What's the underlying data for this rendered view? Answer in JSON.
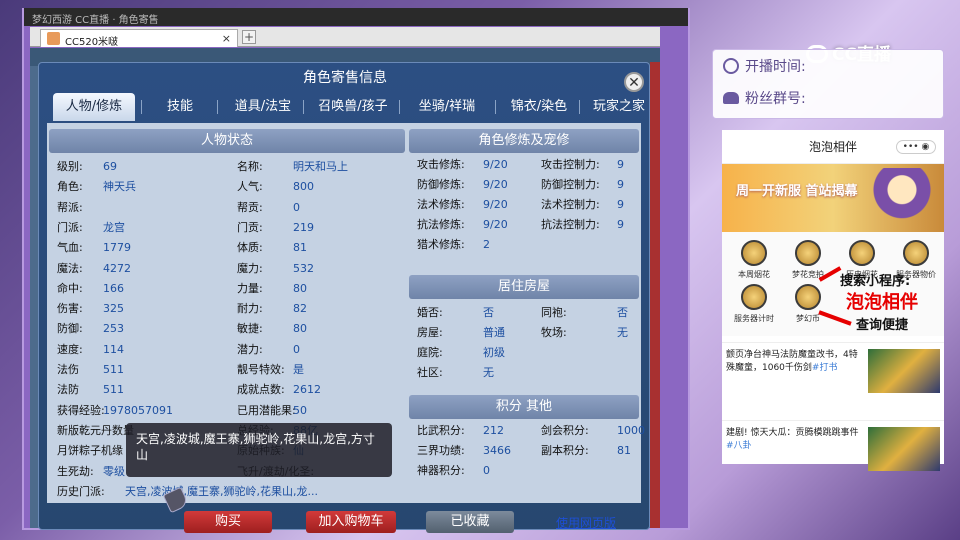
{
  "browser": {
    "tab_title": "CC520米啵",
    "close_glyph": "×",
    "newtab_glyph": "+"
  },
  "panel": {
    "title": "角色寄售信息",
    "close_glyph": "✕",
    "tabs": [
      "人物/修炼",
      "技能",
      "道具/法宝",
      "召唤兽/孩子",
      "坐骑/祥瑞",
      "锦衣/染色",
      "玩家之家"
    ],
    "active_tab": 0
  },
  "status": {
    "header": "人物状态",
    "left": [
      {
        "label": "级别:",
        "value": "69"
      },
      {
        "label": "角色:",
        "value": "神天兵"
      },
      {
        "label": "帮派:",
        "value": ""
      },
      {
        "label": "门派:",
        "value": "龙宫"
      },
      {
        "label": "气血:",
        "value": "1779"
      },
      {
        "label": "魔法:",
        "value": "4272"
      },
      {
        "label": "命中:",
        "value": "166"
      },
      {
        "label": "伤害:",
        "value": "325"
      },
      {
        "label": "防御:",
        "value": "253"
      },
      {
        "label": "速度:",
        "value": "114"
      },
      {
        "label": "法伤",
        "value": "511"
      },
      {
        "label": "法防",
        "value": "511"
      },
      {
        "label": "获得经验:",
        "value": "1978057091"
      },
      {
        "label": "新版乾元丹数量",
        "value": ""
      },
      {
        "label": "月饼粽子机缘",
        "value": ""
      },
      {
        "label": "生死劫:",
        "value": "零级"
      }
    ],
    "right": [
      {
        "label": "名称:",
        "value": "明天和马上"
      },
      {
        "label": "人气:",
        "value": "800"
      },
      {
        "label": "帮贡:",
        "value": "0"
      },
      {
        "label": "门贡:",
        "value": "219"
      },
      {
        "label": "体质:",
        "value": "81"
      },
      {
        "label": "魔力:",
        "value": "532"
      },
      {
        "label": "力量:",
        "value": "80"
      },
      {
        "label": "耐力:",
        "value": "82"
      },
      {
        "label": "敏捷:",
        "value": "80"
      },
      {
        "label": "潜力:",
        "value": "0"
      },
      {
        "label": "靓号特效:",
        "value": "是"
      },
      {
        "label": "成就点数:",
        "value": "2612"
      },
      {
        "label": "已用潜能果:",
        "value": "50"
      },
      {
        "label": "总经验:",
        "value": "88亿"
      },
      {
        "label": "原始种族:",
        "value": "仙"
      },
      {
        "label": "飞升/渡劫/化圣:",
        "value": ""
      }
    ],
    "history_label": "历史门派:",
    "history_value": "天宫,凌波城,魔王寨,狮驼岭,花果山,龙..."
  },
  "cultivation": {
    "header": "角色修炼及宠修",
    "rows": [
      {
        "l1": "攻击修炼:",
        "v1": "9/20",
        "l2": "攻击控制力:",
        "v2": "9"
      },
      {
        "l1": "防御修炼:",
        "v1": "9/20",
        "l2": "防御控制力:",
        "v2": "9"
      },
      {
        "l1": "法术修炼:",
        "v1": "9/20",
        "l2": "法术控制力:",
        "v2": "9"
      },
      {
        "l1": "抗法修炼:",
        "v1": "9/20",
        "l2": "抗法控制力:",
        "v2": "9"
      },
      {
        "l1": "猎术修炼:",
        "v1": "2",
        "l2": "",
        "v2": ""
      }
    ]
  },
  "house": {
    "header": "居住房屋",
    "rows": [
      {
        "l1": "婚否:",
        "v1": "否",
        "l2": "同袍:",
        "v2": "否"
      },
      {
        "l1": "房屋:",
        "v1": "普通",
        "l2": "牧场:",
        "v2": "无"
      },
      {
        "l1": "庭院:",
        "v1": "初级",
        "l2": "",
        "v2": ""
      },
      {
        "l1": "社区:",
        "v1": "无",
        "l2": "",
        "v2": ""
      }
    ]
  },
  "points": {
    "header": "积分 其他",
    "rows": [
      {
        "l1": "比武积分:",
        "v1": "212",
        "l2": "剑会积分:",
        "v2": "1000"
      },
      {
        "l1": "三界功绩:",
        "v1": "3466",
        "l2": "副本积分:",
        "v2": "81"
      },
      {
        "l1": "神器积分:",
        "v1": "0",
        "l2": "",
        "v2": ""
      }
    ]
  },
  "tooltip": "天宫,凌波城,魔王寨,狮驼岭,花果山,龙宫,方寸山",
  "actions": {
    "buy": "购买",
    "cart": "加入购物车",
    "fav": "已收藏",
    "web": "使用网页版"
  },
  "stream": {
    "logo": "CC直播",
    "start_time_label": "开播时间:",
    "fan_group_label": "粉丝群号:"
  },
  "miniapp": {
    "title": "泡泡相伴",
    "menu_glyph": "•••  ◉",
    "banner_text": "周一开新服 首站揭幕",
    "grid": [
      "本周烟花",
      "梦花竞拍",
      "历史烟花",
      "服务器物价",
      "服务器计时",
      "梦幻币"
    ],
    "promo_line1": "搜索小程序:",
    "promo_line2": "泡泡相伴",
    "promo_line3": "查询便捷",
    "news": [
      {
        "text": "颤页净台神马法防魔童改书，4特殊魔童，1060千伤剑",
        "tag": "#打书"
      },
      {
        "text": "建剧! 惊天大瓜：贡腾模跳跳事件",
        "tag": "#八卦"
      }
    ]
  }
}
